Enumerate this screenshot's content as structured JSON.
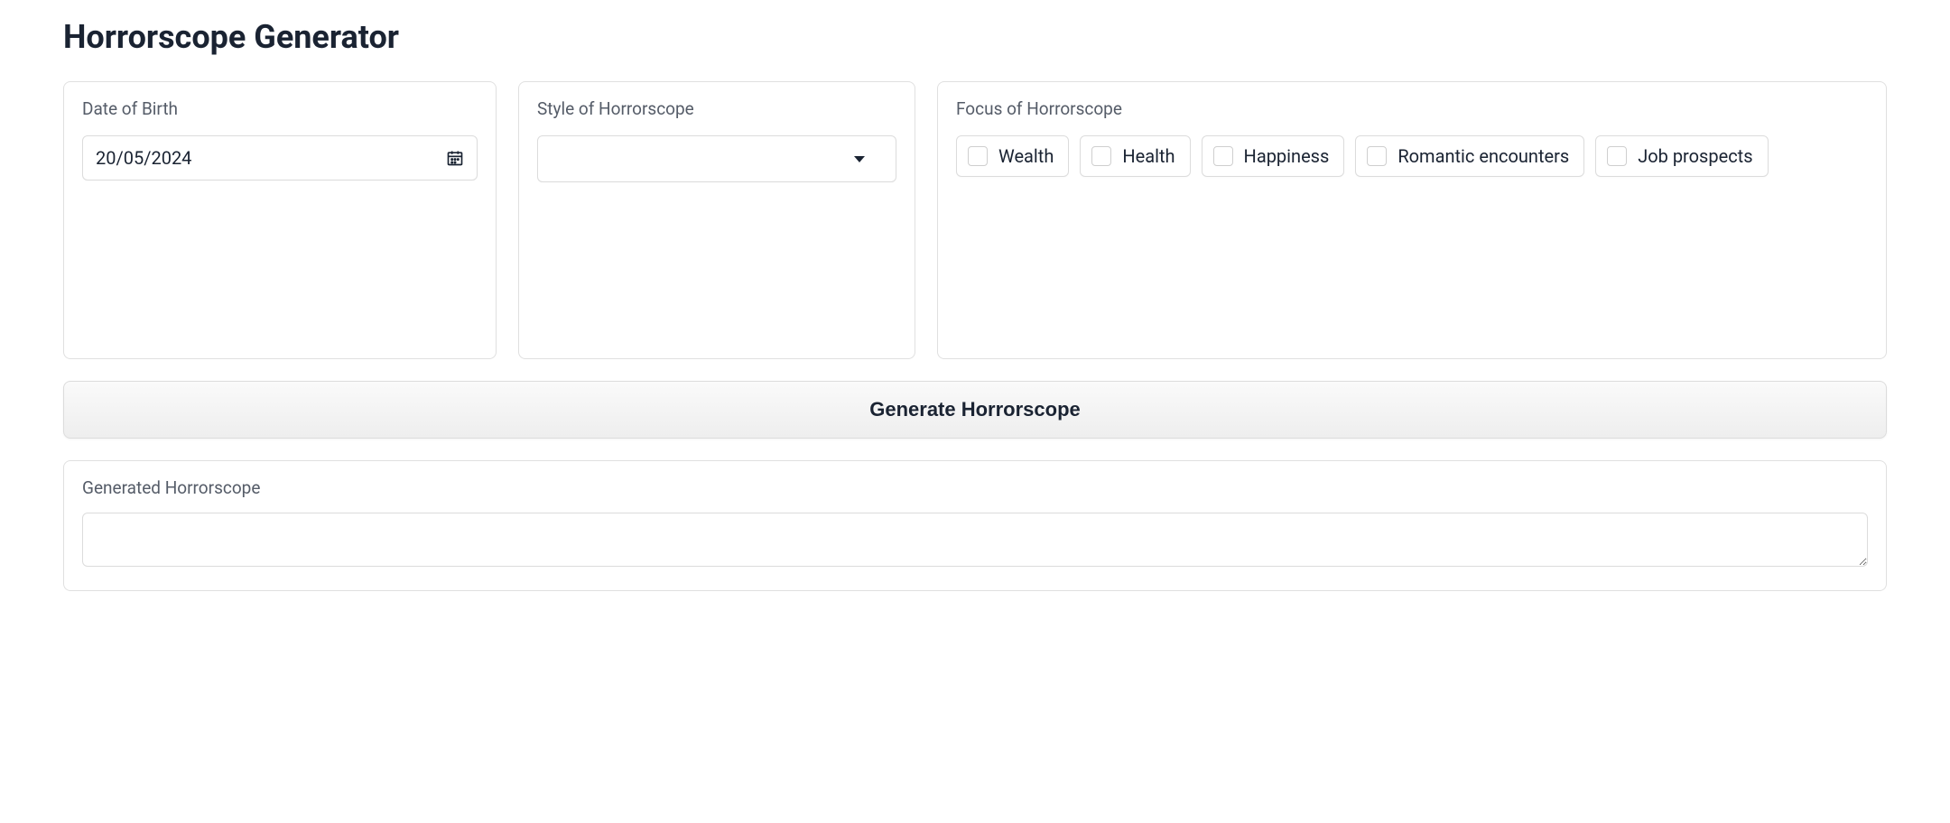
{
  "title": "Horrorscope Generator",
  "dob": {
    "label": "Date of Birth",
    "value": "20/05/2024"
  },
  "style": {
    "label": "Style of Horrorscope",
    "value": ""
  },
  "focus": {
    "label": "Focus of Horrorscope",
    "options": [
      {
        "label": "Wealth",
        "checked": false
      },
      {
        "label": "Health",
        "checked": false
      },
      {
        "label": "Happiness",
        "checked": false
      },
      {
        "label": "Romantic encounters",
        "checked": false
      },
      {
        "label": "Job prospects",
        "checked": false
      }
    ]
  },
  "generate_button": "Generate Horrorscope",
  "output": {
    "label": "Generated Horrorscope",
    "value": ""
  }
}
